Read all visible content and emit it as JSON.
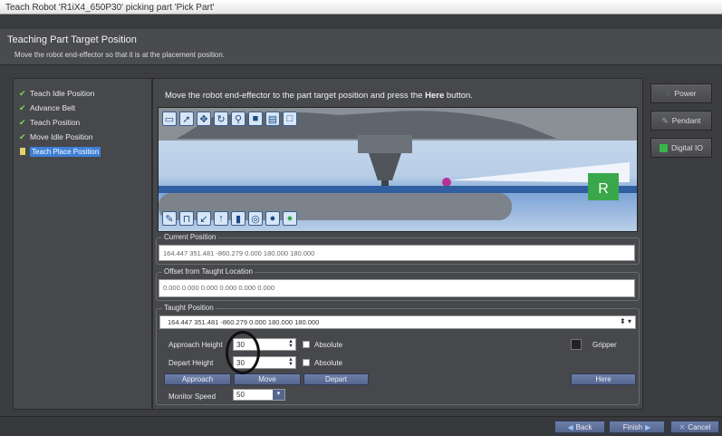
{
  "window": {
    "title": "Teach Robot 'R1iX4_650P30' picking part 'Pick Part'"
  },
  "header": {
    "title": "Teaching Part Target Position",
    "subtitle": "Move the robot end-effector so that it is at the placement position."
  },
  "steps": [
    {
      "label": "Teach Idle Position",
      "done": true
    },
    {
      "label": "Advance Belt",
      "done": true
    },
    {
      "label": "Teach Position",
      "done": true
    },
    {
      "label": "Move Idle Position",
      "done": true
    },
    {
      "label": "Teach Place Position",
      "active": true
    }
  ],
  "instruction": {
    "before": "Move the robot end-effector to the part target position and press the ",
    "bold": "Here",
    "after": " button."
  },
  "viewport": {
    "label_letter": "R",
    "toolbar_top_icons": [
      "window-icon",
      "pointer-icon",
      "move-icon",
      "rotate-icon",
      "zoom-icon",
      "cube-icon",
      "document-icon",
      "box-icon"
    ],
    "toolbar_bottom_icons": [
      "edit-icon",
      "ruler-icon",
      "axis-icon",
      "arrow-up-icon",
      "cylinder-icon",
      "orbit-icon",
      "sphere-icon",
      "green-dot-icon"
    ]
  },
  "current_position": {
    "label": "Current Position",
    "value": "164.447 351.481 -860.279 0.000 180.000 180.000"
  },
  "offset": {
    "label": "Offset from Taught Location",
    "value": "0.000 0.000 0.000 0.000 0.000 0.000"
  },
  "taught_position": {
    "label": "Taught Position",
    "value": "164.447 351.481 -860.279 0.000 180.000 180.000",
    "approach_height_label": "Approach Height",
    "approach_height_value": "30",
    "depart_height_label": "Depart Height",
    "depart_height_value": "30",
    "absolute_label": "Absolute",
    "gripper_label": "Gripper",
    "monitor_speed_label": "Monitor Speed",
    "monitor_speed_value": "50"
  },
  "buttons": {
    "approach": "Approach",
    "move": "Move",
    "depart": "Depart",
    "here": "Here"
  },
  "side_buttons": {
    "power": "Power",
    "pendant": "Pendant",
    "digital_io": "Digital IO"
  },
  "footer": {
    "back": "Back",
    "finish": "Finish",
    "cancel": "Cancel"
  },
  "colors": {
    "accent": "#3d7fd6",
    "check": "#7bd85a",
    "green_marker": "#3aa84a",
    "digital_io": "#39b54a"
  }
}
